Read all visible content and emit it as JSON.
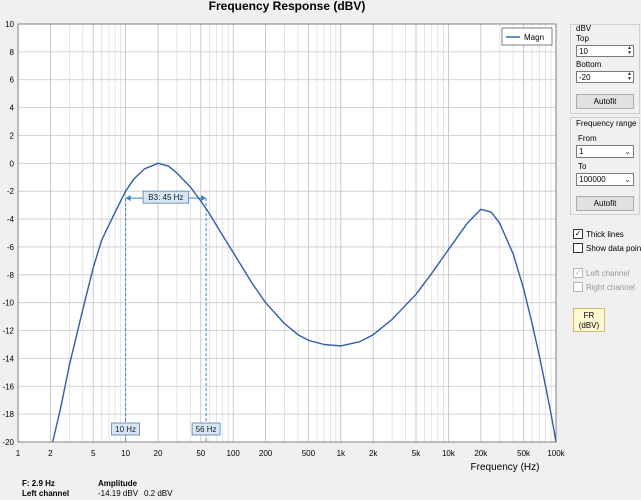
{
  "chart_data": {
    "type": "line",
    "title": "Frequency Response (dBV)",
    "xlabel": "Frequency (Hz)",
    "ylabel": "",
    "xscale": "log",
    "xlim": [
      1,
      100000
    ],
    "ylim": [
      -20,
      10
    ],
    "grid": true,
    "legend_position": "top-right",
    "x_ticks": [
      "1",
      "2",
      "5",
      "10",
      "20",
      "50",
      "100",
      "200",
      "500",
      "1k",
      "2k",
      "5k",
      "10k",
      "20k",
      "50k",
      "100k"
    ],
    "y_ticks": [
      "10",
      "8",
      "6",
      "4",
      "2",
      "0",
      "-2",
      "-4",
      "-6",
      "-8",
      "-10",
      "-12",
      "-14",
      "-16",
      "-18",
      "-20"
    ],
    "series": [
      {
        "name": "Magn",
        "color": "#2e5fa8",
        "x": [
          2.1,
          2.5,
          3,
          4,
          5,
          6,
          8,
          10,
          12,
          15,
          20,
          25,
          30,
          40,
          50,
          60,
          80,
          100,
          150,
          200,
          300,
          400,
          500,
          700,
          1000,
          1500,
          2000,
          3000,
          5000,
          7000,
          10000,
          15000,
          20000,
          25000,
          30000,
          40000,
          50000,
          60000,
          70000,
          80000,
          90000,
          100000
        ],
        "y": [
          -20,
          -17.5,
          -14.5,
          -10.5,
          -7.5,
          -5.5,
          -3.5,
          -2.0,
          -1.1,
          -0.4,
          0.0,
          -0.2,
          -0.7,
          -1.7,
          -2.7,
          -3.6,
          -5.2,
          -6.4,
          -8.6,
          -10.0,
          -11.5,
          -12.3,
          -12.7,
          -13.0,
          -13.1,
          -12.8,
          -12.3,
          -11.2,
          -9.4,
          -7.9,
          -6.2,
          -4.3,
          -3.3,
          -3.5,
          -4.3,
          -6.5,
          -9.0,
          -11.5,
          -13.8,
          -16.0,
          -18.0,
          -20
        ]
      }
    ],
    "annotations": [
      {
        "label": "B3: 45 Hz",
        "x_from": 10,
        "x_to": 56,
        "y": -2.5
      },
      {
        "label": "10 Hz",
        "x": 10
      },
      {
        "label": "56 Hz",
        "x": 56
      }
    ]
  },
  "sidebar": {
    "dbv_group": "dBV",
    "top_label": "Top",
    "top_value": "10",
    "bottom_label": "Bottom",
    "bottom_value": "-20",
    "autofit_label": "Autofit",
    "freq_group": "Frequency range",
    "from_label": "From",
    "from_value": "1",
    "to_label": "To",
    "to_value": "100000",
    "autofit2_label": "Autofit",
    "thick_lines": "Thick lines",
    "show_points": "Show data points",
    "left_channel": "Left channel",
    "right_channel": "Right channel",
    "fr_line1": "FR",
    "fr_line2": "(dBV)"
  },
  "status": {
    "freq": "F: 2.9 Hz",
    "channel": "Left channel",
    "amp_header": "Amplitude",
    "amp_value": "-14.19 dBV",
    "amp_delta": "0.2 dBV"
  }
}
